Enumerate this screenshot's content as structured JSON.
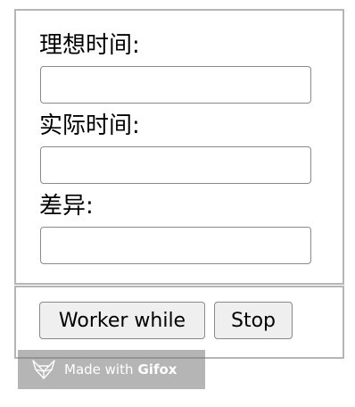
{
  "form": {
    "ideal_time_label": "理想时间:",
    "ideal_time_value": "",
    "actual_time_label": "实际时间:",
    "actual_time_value": "",
    "difference_label": "差异:",
    "difference_value": ""
  },
  "controls": {
    "worker_while_label": "Worker while",
    "stop_label": "Stop"
  },
  "watermark": {
    "text": "Made with",
    "brand": "Gifox"
  }
}
